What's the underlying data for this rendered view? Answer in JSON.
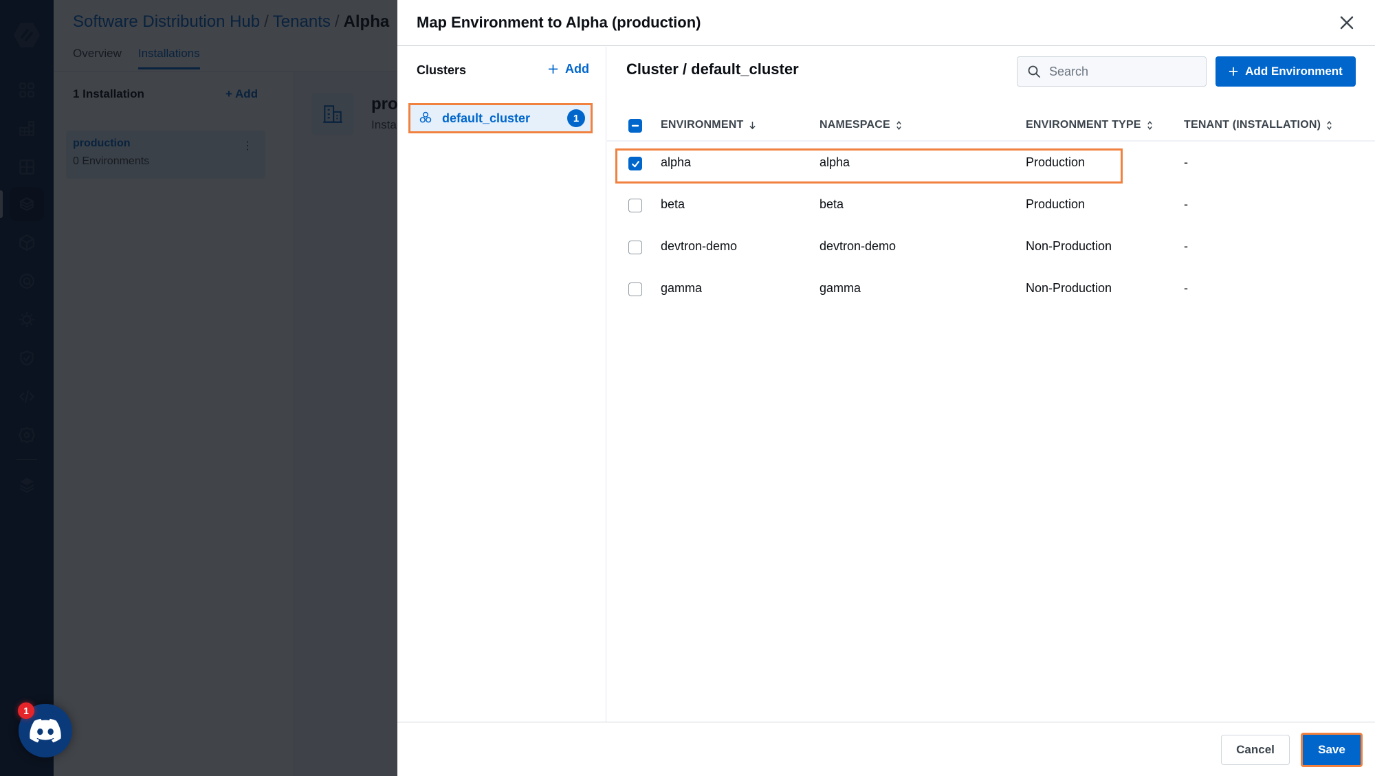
{
  "background": {
    "breadcrumb": [
      {
        "label": "Software Distribution Hub",
        "link": true
      },
      {
        "label": "Tenants",
        "link": true
      },
      {
        "label": "Alpha",
        "link": false
      }
    ],
    "tabs": [
      {
        "label": "Overview",
        "active": false
      },
      {
        "label": "Installations",
        "active": true
      }
    ],
    "installations_heading": "1 Installation",
    "add_label": "Add",
    "installation": {
      "name": "production",
      "subtitle": "0 Environments"
    },
    "card": {
      "title": "production",
      "subtitle": "Installation"
    },
    "sidebar_icons": [
      "devtron-logo-icon",
      "overview-grid-icon",
      "apps-chart-icon",
      "application-groups-icon",
      "software-distribution-hub-icon",
      "chart-store-box-icon",
      "resource-browser-icon",
      "global-config-gear-icon",
      "security-shield-icon",
      "bulk-edit-code-icon",
      "settings-gear-icon",
      "stack-manager-icon"
    ],
    "discord_badge": "1"
  },
  "modal": {
    "title": "Map Environment to Alpha (production)",
    "clusters": {
      "heading": "Clusters",
      "add_label": "Add",
      "items": [
        {
          "name": "default_cluster",
          "count": "1",
          "selected": true
        }
      ]
    },
    "env_panel": {
      "title": "Cluster / default_cluster",
      "search_placeholder": "Search",
      "search_value": "",
      "add_env_label": "Add Environment",
      "columns": [
        {
          "label": "ENVIRONMENT",
          "sort": "desc"
        },
        {
          "label": "NAMESPACE",
          "sort": "none"
        },
        {
          "label": "ENVIRONMENT TYPE",
          "sort": "none"
        },
        {
          "label": "TENANT (INSTALLATION)",
          "sort": "none"
        }
      ],
      "select_all_state": "partial",
      "rows": [
        {
          "environment": "alpha",
          "namespace": "alpha",
          "type": "Production",
          "tenant": "-",
          "checked": true
        },
        {
          "environment": "beta",
          "namespace": "beta",
          "type": "Production",
          "tenant": "-",
          "checked": false
        },
        {
          "environment": "devtron-demo",
          "namespace": "devtron-demo",
          "type": "Non-Production",
          "tenant": "-",
          "checked": false
        },
        {
          "environment": "gamma",
          "namespace": "gamma",
          "type": "Non-Production",
          "tenant": "-",
          "checked": false
        }
      ]
    },
    "footer": {
      "cancel_label": "Cancel",
      "save_label": "Save"
    }
  },
  "colors": {
    "accent": "#0066cc",
    "highlight_outline": "#f0813f",
    "sidebar": "#0b2346"
  }
}
